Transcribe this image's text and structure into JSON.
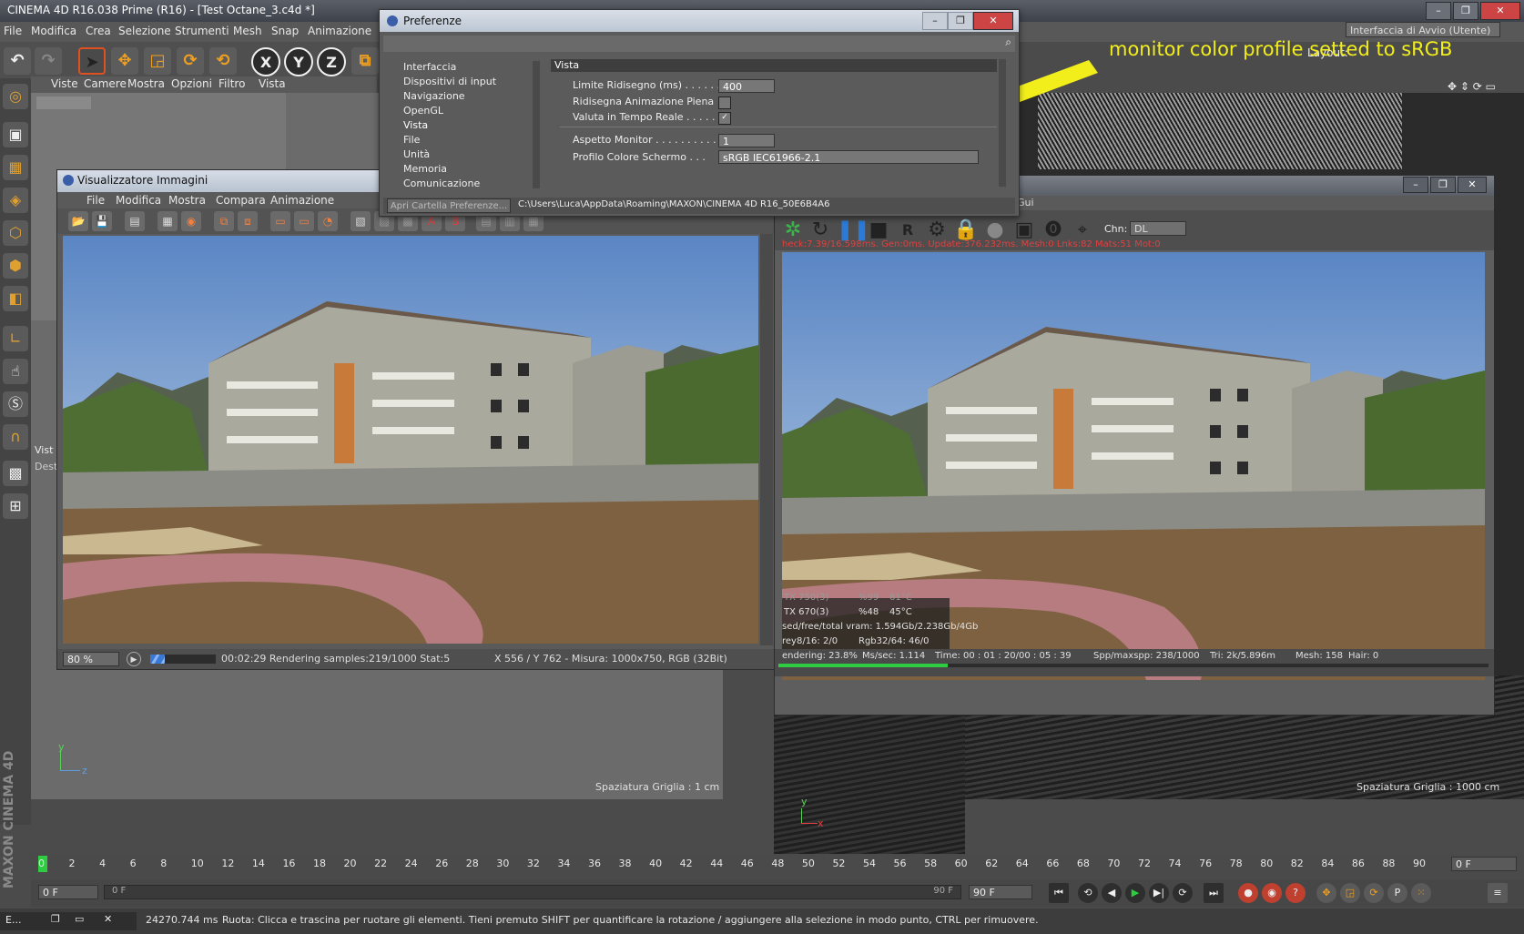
{
  "app": {
    "title": "CINEMA 4D R16.038 Prime (R16) - [Test Octane_3.c4d *]",
    "menu": [
      "File",
      "Modifica",
      "Crea",
      "Selezione",
      "Strumenti",
      "Mesh",
      "Snap",
      "Animazione"
    ],
    "layout_label": "Layout:",
    "layout_value": "Interfaccia di Avvio (Utente)",
    "vertical_logo": "MAXON CINEMA 4D"
  },
  "toolbar": {
    "undo_glyph": "↶",
    "axis_x": "X",
    "axis_y": "Y",
    "axis_z": "Z"
  },
  "viewport_left": {
    "menu": [
      "Viste",
      "Camere",
      "Mostra",
      "Opzioni",
      "Filtro",
      "Vista"
    ],
    "grid_label": "Spaziatura Griglia : 1 cm",
    "side_tab_1": "Vist",
    "side_tab_2": "Dest",
    "axis_y": "y",
    "axis_z": "z"
  },
  "viewport_right": {
    "grid_label": "Spaziatura Griglia : 1000 cm",
    "axis_y": "y",
    "axis_x": "x"
  },
  "annotation": {
    "text": "monitor color profile setted to sRGB",
    "color": "#f2ee1c"
  },
  "image_viewer": {
    "title": "Visualizzatore Immagini",
    "menu": [
      "File",
      "Modifica",
      "Mostra",
      "Compara",
      "Animazione"
    ],
    "zoom": "80 %",
    "render_status": "00:02:29 Rendering samples:219/1000 Stat:5",
    "info": "X 556 / Y 762 - Misura: 1000x750, RGB (32Bit)",
    "render_progress": 0.22
  },
  "octane": {
    "title_fragment": "Gui",
    "chn_label": "Chn:",
    "chn_value": "DL",
    "log": "heck:7.39/16.598ms. Gen:0ms. Update:376.232ms. Mesh:0 Lnks:82 Mats:51 Mot:0",
    "gpu1_name": "TX 750(3)",
    "gpu1_pct": "%99",
    "gpu1_temp": "61°C",
    "gpu2_name": "TX 670(3)",
    "gpu2_pct": "%48",
    "gpu2_temp": "45°C",
    "vram": "sed/free/total vram: 1.594Gb/2.238Gb/4Gb",
    "grey": "rey8/16: 2/0",
    "rgb": "Rgb32/64: 46/0",
    "rendering": "endering: 23.8%",
    "mssec": "Ms/sec: 1.114",
    "time": "Time: 00 : 01 : 20/00 : 05 : 39",
    "spp": "Spp/maxspp: 238/1000",
    "tri": "Tri: 2k/5.896m",
    "mesh": "Mesh: 158",
    "hair": "Hair: 0",
    "progress": 0.238
  },
  "preferences": {
    "title": "Preferenze",
    "tree": [
      "Interfaccia",
      "Dispositivi di input",
      "Navigazione",
      "OpenGL",
      "Vista",
      "File",
      "Unità",
      "Memoria",
      "Comunicazione"
    ],
    "selected": "Vista",
    "section": "Vista",
    "rows": {
      "limite_label": "Limite Ridisegno (ms) . . . . . .",
      "limite_value": "400",
      "ridisegna_label": "Ridisegna Animazione Piena",
      "ridisegna_checked": false,
      "valuta_label": "Valuta in Tempo Reale . . . . .",
      "valuta_checked": true,
      "aspetto_label": "Aspetto Monitor . . . . . . . . . .",
      "aspetto_value": "1",
      "profilo_label": "Profilo Colore Schermo . . .",
      "profilo_value": "sRGB IEC61966-2.1"
    },
    "open_folder_button": "Apri Cartella Preferenze...",
    "path": "C:\\Users\\Luca\\AppData\\Roaming\\MAXON\\CINEMA 4D R16_50E6B4A6"
  },
  "timeline": {
    "ticks": [
      "0",
      "2",
      "4",
      "6",
      "8",
      "10",
      "12",
      "14",
      "16",
      "18",
      "20",
      "22",
      "24",
      "26",
      "28",
      "30",
      "32",
      "34",
      "36",
      "38",
      "40",
      "42",
      "44",
      "46",
      "48",
      "50",
      "52",
      "54",
      "56",
      "58",
      "60",
      "62",
      "64",
      "66",
      "68",
      "70",
      "72",
      "74",
      "76",
      "78",
      "80",
      "82",
      "84",
      "86",
      "88",
      "90"
    ],
    "current_frame": "0 F",
    "start_field": "0 F",
    "min_field": "0 F",
    "max_field": "90 F",
    "end_field": "90 F",
    "right_field": "0 F"
  },
  "statusbar": {
    "task": "E...",
    "time_ms": "24270.744 ms",
    "message": "Ruota: Clicca e trascina per ruotare gli elementi. Tieni premuto SHIFT per quantificare la rotazione / aggiungere alla selezione in modo punto, CTRL per rimuovere."
  }
}
